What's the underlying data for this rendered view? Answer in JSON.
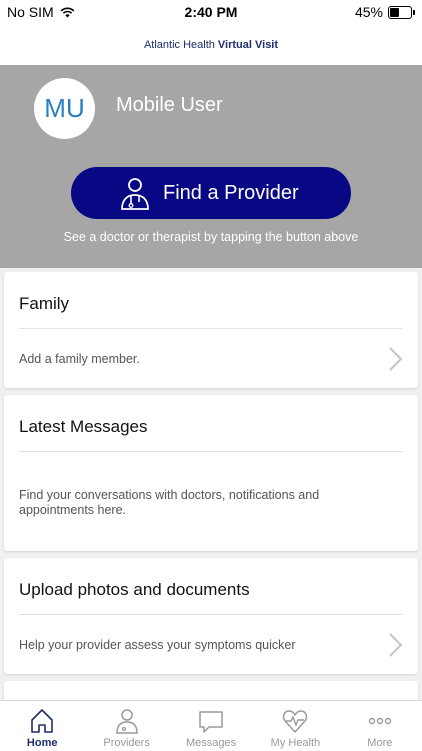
{
  "status_bar": {
    "carrier": "No SIM",
    "time": "2:40 PM",
    "battery": "45%",
    "battery_level": 0.45
  },
  "header": {
    "brand_regular": "Atlantic Health",
    "brand_bold": "Virtual Visit"
  },
  "profile": {
    "initials": "MU",
    "name": "Mobile User"
  },
  "find_provider": {
    "label": "Find a Provider",
    "caption": "See a doctor or therapist by tapping the button above"
  },
  "cards": [
    {
      "title": "Family",
      "description": "Add a family member."
    },
    {
      "title": "Latest Messages",
      "description": "Find your conversations with doctors, notifications and appointments here."
    },
    {
      "title": "Upload photos and documents",
      "description": "Help your provider assess your symptoms quicker"
    }
  ],
  "tabs": [
    {
      "label": "Home",
      "icon": "home-icon",
      "active": true
    },
    {
      "label": "Providers",
      "icon": "provider-icon",
      "active": false
    },
    {
      "label": "Messages",
      "icon": "message-icon",
      "active": false
    },
    {
      "label": "My Health",
      "icon": "heart-icon",
      "active": false
    },
    {
      "label": "More",
      "icon": "more-icon",
      "active": false
    }
  ],
  "colors": {
    "hero_bg": "#a6a6a6",
    "button_bg": "#080784",
    "brand": "#1e2f6b",
    "avatar_text": "#2a7fc2"
  }
}
